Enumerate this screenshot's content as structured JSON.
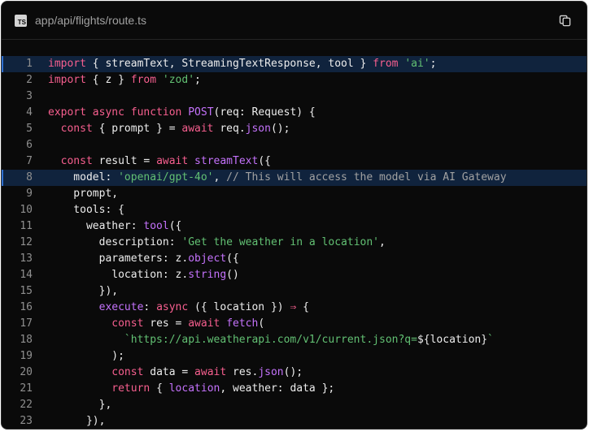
{
  "header": {
    "file_icon": "typescript-file-icon",
    "file_badge": "TS",
    "file_path": "app/api/flights/route.ts",
    "copy_icon": "copy-icon"
  },
  "colors": {
    "background": "#0a0a0a",
    "keyword": "#f75f8f",
    "function": "#c472fb",
    "string": "#62c073",
    "comment": "#a1a1a1",
    "highlight": "#10233d"
  },
  "code": {
    "highlighted_lines": [
      1,
      8
    ],
    "lines": [
      {
        "n": "1",
        "tokens": [
          {
            "t": "import",
            "c": "k"
          },
          {
            "t": " { streamText, StreamingTextResponse, tool } "
          },
          {
            "t": "from",
            "c": "k"
          },
          {
            "t": " "
          },
          {
            "t": "'ai'",
            "c": "s"
          },
          {
            "t": ";"
          }
        ]
      },
      {
        "n": "2",
        "tokens": [
          {
            "t": "import",
            "c": "k"
          },
          {
            "t": " { z } "
          },
          {
            "t": "from",
            "c": "k"
          },
          {
            "t": " "
          },
          {
            "t": "'zod'",
            "c": "s"
          },
          {
            "t": ";"
          }
        ]
      },
      {
        "n": "3",
        "tokens": []
      },
      {
        "n": "4",
        "tokens": [
          {
            "t": "export",
            "c": "k"
          },
          {
            "t": " "
          },
          {
            "t": "async",
            "c": "k"
          },
          {
            "t": " "
          },
          {
            "t": "function",
            "c": "k"
          },
          {
            "t": " "
          },
          {
            "t": "POST",
            "c": "f"
          },
          {
            "t": "(req: Request) {"
          }
        ]
      },
      {
        "n": "5",
        "tokens": [
          {
            "t": "  "
          },
          {
            "t": "const",
            "c": "k"
          },
          {
            "t": " { prompt } = "
          },
          {
            "t": "await",
            "c": "k"
          },
          {
            "t": " req."
          },
          {
            "t": "json",
            "c": "f"
          },
          {
            "t": "();"
          }
        ]
      },
      {
        "n": "6",
        "tokens": []
      },
      {
        "n": "7",
        "tokens": [
          {
            "t": "  "
          },
          {
            "t": "const",
            "c": "k"
          },
          {
            "t": " result = "
          },
          {
            "t": "await",
            "c": "k"
          },
          {
            "t": " "
          },
          {
            "t": "streamText",
            "c": "f"
          },
          {
            "t": "({"
          }
        ]
      },
      {
        "n": "8",
        "tokens": [
          {
            "t": "    model: "
          },
          {
            "t": "'openai/gpt-4o'",
            "c": "s"
          },
          {
            "t": ", "
          },
          {
            "t": "// This will access the model via AI Gateway",
            "c": "c"
          }
        ]
      },
      {
        "n": "9",
        "tokens": [
          {
            "t": "    prompt,"
          }
        ]
      },
      {
        "n": "10",
        "tokens": [
          {
            "t": "    tools: {"
          }
        ]
      },
      {
        "n": "11",
        "tokens": [
          {
            "t": "      weather: "
          },
          {
            "t": "tool",
            "c": "f"
          },
          {
            "t": "({"
          }
        ]
      },
      {
        "n": "12",
        "tokens": [
          {
            "t": "        description: "
          },
          {
            "t": "'Get the weather in a location'",
            "c": "s"
          },
          {
            "t": ","
          }
        ]
      },
      {
        "n": "13",
        "tokens": [
          {
            "t": "        parameters: z."
          },
          {
            "t": "object",
            "c": "f"
          },
          {
            "t": "({"
          }
        ]
      },
      {
        "n": "14",
        "tokens": [
          {
            "t": "          location: z."
          },
          {
            "t": "string",
            "c": "f"
          },
          {
            "t": "()"
          }
        ]
      },
      {
        "n": "15",
        "tokens": [
          {
            "t": "        }),"
          }
        ]
      },
      {
        "n": "16",
        "tokens": [
          {
            "t": "        "
          },
          {
            "t": "execute",
            "c": "f"
          },
          {
            "t": ": "
          },
          {
            "t": "async",
            "c": "k"
          },
          {
            "t": " ({ location }) "
          },
          {
            "t": "⇒",
            "c": "k"
          },
          {
            "t": " {"
          }
        ]
      },
      {
        "n": "17",
        "tokens": [
          {
            "t": "          "
          },
          {
            "t": "const",
            "c": "k"
          },
          {
            "t": " res = "
          },
          {
            "t": "await",
            "c": "k"
          },
          {
            "t": " "
          },
          {
            "t": "fetch",
            "c": "f"
          },
          {
            "t": "("
          }
        ]
      },
      {
        "n": "18",
        "tokens": [
          {
            "t": "            "
          },
          {
            "t": "`https://api.weatherapi.com/v1/current.json?q=",
            "c": "s"
          },
          {
            "t": "${location}"
          },
          {
            "t": "`",
            "c": "s"
          }
        ]
      },
      {
        "n": "19",
        "tokens": [
          {
            "t": "          );"
          }
        ]
      },
      {
        "n": "20",
        "tokens": [
          {
            "t": "          "
          },
          {
            "t": "const",
            "c": "k"
          },
          {
            "t": " data = "
          },
          {
            "t": "await",
            "c": "k"
          },
          {
            "t": " res."
          },
          {
            "t": "json",
            "c": "f"
          },
          {
            "t": "();"
          }
        ]
      },
      {
        "n": "21",
        "tokens": [
          {
            "t": "          "
          },
          {
            "t": "return",
            "c": "k"
          },
          {
            "t": " { "
          },
          {
            "t": "location",
            "c": "f"
          },
          {
            "t": ", weather: data };"
          }
        ]
      },
      {
        "n": "22",
        "tokens": [
          {
            "t": "        },"
          }
        ]
      },
      {
        "n": "23",
        "tokens": [
          {
            "t": "      }),"
          }
        ]
      }
    ]
  }
}
